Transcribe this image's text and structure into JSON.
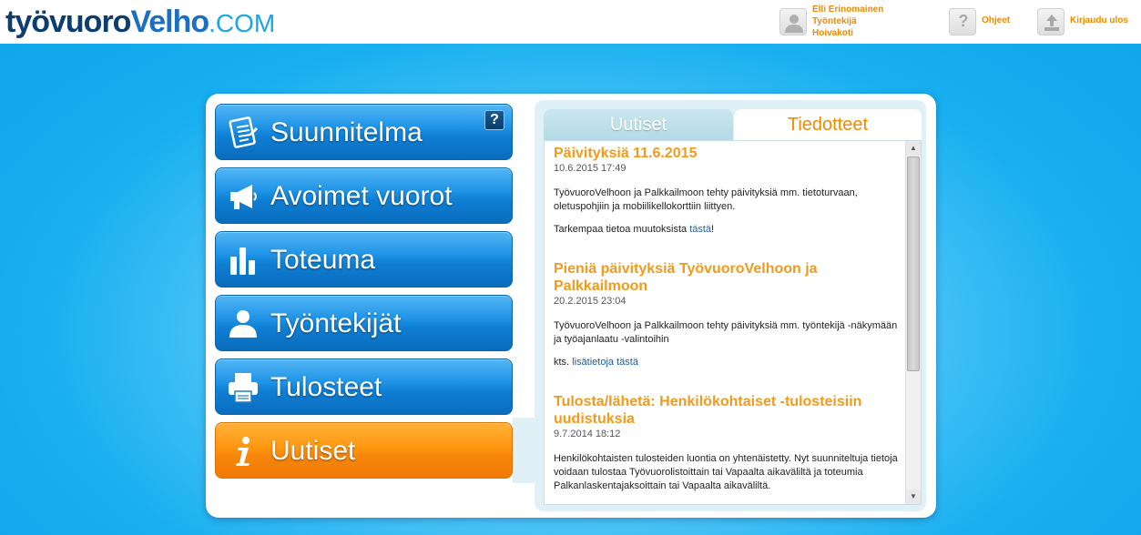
{
  "brand": {
    "part1": "työvuoro",
    "part2": "Velho",
    "part3": ".COM"
  },
  "user": {
    "name": "Elli Erinomainen",
    "role": "Työntekijä",
    "unit": "Hoivakoti"
  },
  "header": {
    "help_label": "Ohjeet",
    "logout_label": "Kirjaudu ulos",
    "help_icon": "?"
  },
  "menu": {
    "help_badge": "?",
    "items": [
      {
        "label": "Suunnitelma",
        "icon": "checklist-icon"
      },
      {
        "label": "Avoimet vuorot",
        "icon": "megaphone-icon"
      },
      {
        "label": "Toteuma",
        "icon": "bar-chart-icon"
      },
      {
        "label": "Työntekijät",
        "icon": "person-icon"
      },
      {
        "label": "Tulosteet",
        "icon": "printer-icon"
      },
      {
        "label": "Uutiset",
        "icon": "info-icon",
        "active": true
      }
    ]
  },
  "tabs": {
    "news": "Uutiset",
    "bulletins": "Tiedotteet",
    "active": "Tiedotteet"
  },
  "articles": [
    {
      "title": "Päivityksiä 11.6.2015",
      "date": "10.6.2015 17:49",
      "p1": "TyövuoroVelhoon ja Palkkailmoon tehty päivityksiä mm. tietoturvaan, oletuspohjiin ja mobiilikellokorttiin liittyen.",
      "p2_prefix": "Tarkempaa tietoa muutoksista ",
      "p2_link": "tästä",
      "p2_suffix": "!"
    },
    {
      "title": "Pieniä päivityksiä TyövuoroVelhoon ja Palkkailmoon",
      "date": "20.2.2015 23:04",
      "p1": "TyövuoroVelhoon ja Palkkailmoon tehty päivityksiä mm. työntekijä -näkymään ja työajanlaatu -valintoihin",
      "p2_prefix": "kts. ",
      "p2_link": "lisätietoja tästä",
      "p2_suffix": ""
    },
    {
      "title": "Tulosta/lähetä: Henkilökohtaiset -tulosteisiin uudistuksia",
      "date": "9.7.2014 18:12",
      "p1": "Henkilökohtaisten tulosteiden luontia on yhtenäistetty. Nyt suunniteltuja tietoja voidaan tulostaa Työvuorolistoittain tai Vapaalta aikaväliltä ja toteumia Palkanlaskentajaksoittain tai Vapaalta aikaväliltä.",
      "p2_prefix": "",
      "p2_link": "",
      "p2_suffix": ""
    }
  ],
  "colors": {
    "accent": "#f08a00",
    "menu_blue": "#1f93e6",
    "menu_active": "#ff9710",
    "link": "#1a5fa8"
  }
}
